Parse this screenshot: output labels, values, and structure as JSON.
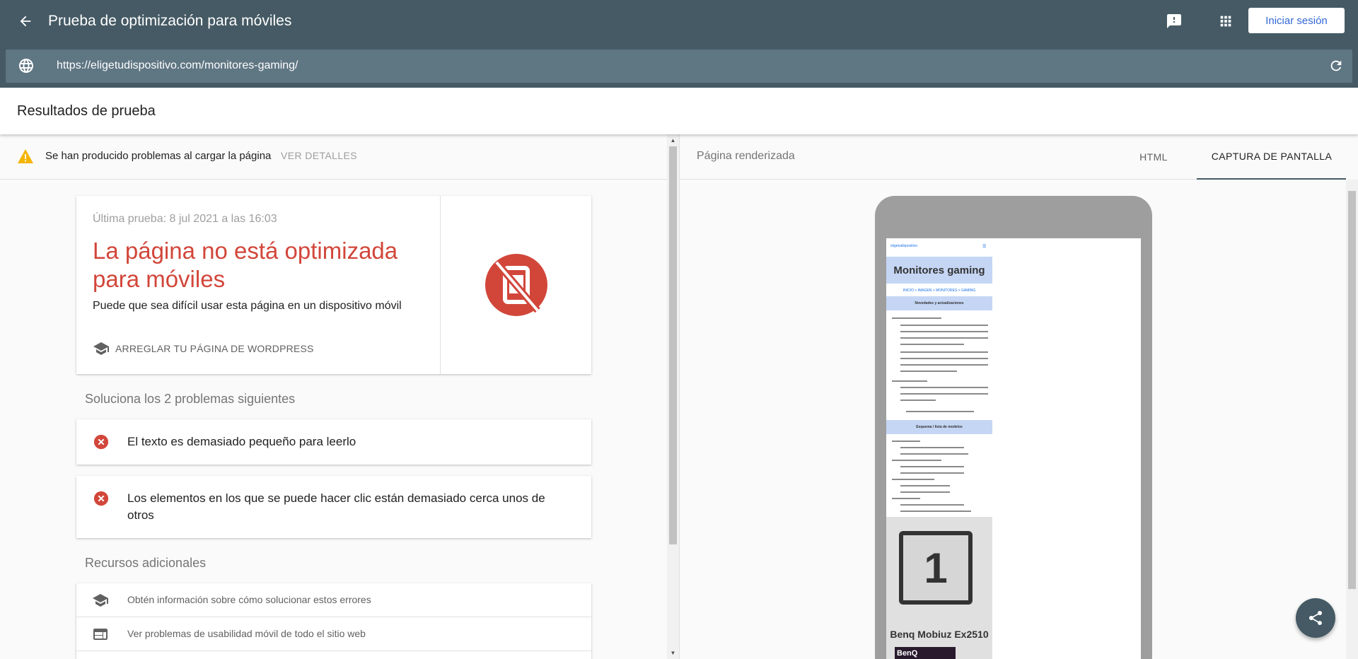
{
  "header": {
    "title": "Prueba de optimización para móviles",
    "signin_label": "Iniciar sesión",
    "url_value": "https://eligetudispositivo.com/monitores-gaming/"
  },
  "results": {
    "title": "Resultados de prueba"
  },
  "warning": {
    "text": "Se han producido problemas al cargar la página",
    "link": "VER DETALLES"
  },
  "verdict": {
    "last_test": "Última prueba: 8 jul 2021 a las 16:03",
    "title": "La página no está optimizada para móviles",
    "subtitle": "Puede que sea difícil usar esta página en un dispositivo móvil",
    "wordpress_fix": "ARREGLAR TU PÁGINA DE WORDPRESS"
  },
  "issues": {
    "heading": "Soluciona los 2 problemas siguientes",
    "items": [
      {
        "text": "El texto es demasiado pequeño para leerlo"
      },
      {
        "text": "Los elementos en los que se puede hacer clic están demasiado cerca unos de otros"
      }
    ]
  },
  "resources": {
    "heading": "Recursos adicionales",
    "items": [
      {
        "text": "Obtén información sobre cómo solucionar estos errores"
      },
      {
        "text": "Ver problemas de usabilidad móvil de todo el sitio web"
      }
    ]
  },
  "rendered": {
    "label": "Página renderizada",
    "tabs": [
      {
        "label": "HTML"
      },
      {
        "label": "CAPTURA DE PANTALLA"
      }
    ],
    "site": {
      "logo": "eligetudispositivo",
      "hero": "Monitores gaming",
      "crumbs": "INICIO > IMAGEN > MONITORES > GAMING",
      "band1": "Novedades y actualizaciones",
      "band2": "Esquema / lista de modelos",
      "badge": "1",
      "product": "Benq Mobiuz Ex2510",
      "product_img": "BenQ"
    }
  },
  "colors": {
    "appbar": "#455a64",
    "error": "#d2463a",
    "warning": "#f4b400"
  }
}
